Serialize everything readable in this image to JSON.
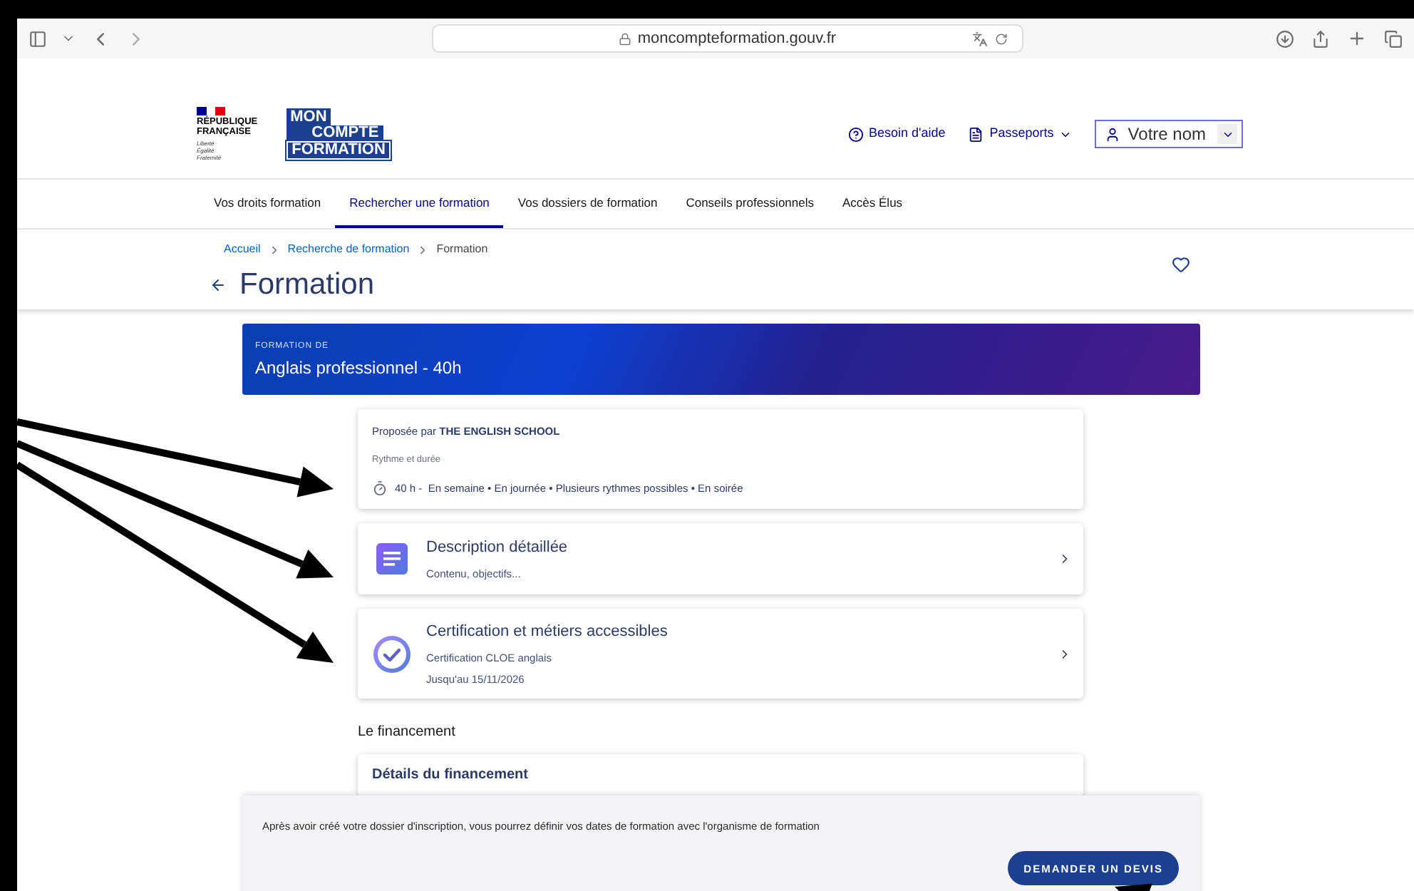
{
  "browser": {
    "url": "moncompteformation.gouv.fr"
  },
  "header": {
    "gov_lines": [
      "RÉPUBLIQUE",
      "FRANÇAISE"
    ],
    "motto": [
      "Liberté",
      "Égalité",
      "Fraternité"
    ],
    "brand_lines": [
      "MON",
      "COMPTE",
      "FORMATION"
    ],
    "links": [
      {
        "label": "Besoin d'aide",
        "kind": "help"
      },
      {
        "label": "Passeports",
        "kind": "doc"
      }
    ],
    "user": {
      "label": "Votre nom"
    }
  },
  "nav": [
    {
      "label": "Vos droits formation",
      "selected": false
    },
    {
      "label": "Rechercher une formation",
      "selected": true
    },
    {
      "label": "Vos dossiers de formation",
      "selected": false
    },
    {
      "label": "Conseils professionnels",
      "selected": false
    },
    {
      "label": "Accès Élus",
      "selected": false
    }
  ],
  "breadcrumb": [
    {
      "label": "Accueil",
      "link": true
    },
    {
      "label": "Recherche de formation",
      "link": true
    },
    {
      "label": "Formation",
      "link": false
    }
  ],
  "page_title": "Formation",
  "banner": {
    "overline": "FORMATION DE",
    "title": "Anglais professionnel - 40h"
  },
  "summary": {
    "provider": "Proposée par **THE ENGLISH SCHOOL**",
    "rhythm_label": "Rythme et durée",
    "rhythm": "40 h -  En semaine • En journée • Plusieurs rythmes possibles • En soirée"
  },
  "sections": [
    {
      "kind": "description",
      "title": "Description détaillée",
      "lines": [
        "Contenu, objectifs..."
      ]
    },
    {
      "kind": "certification",
      "title": "Certification et métiers accessibles",
      "lines": [
        "Certification CLOE anglais",
        "Jusqu'au 15/11/2026"
      ]
    }
  ],
  "financing": {
    "heading": "Le financement",
    "card_title": "Détails du financement"
  },
  "footer_bar": {
    "message": "Après avoir créé votre dossier d'inscription, vous pourrez définir vos dates de formation avec l'organisme de formation",
    "button": "DEMANDER UN DEVIS"
  }
}
